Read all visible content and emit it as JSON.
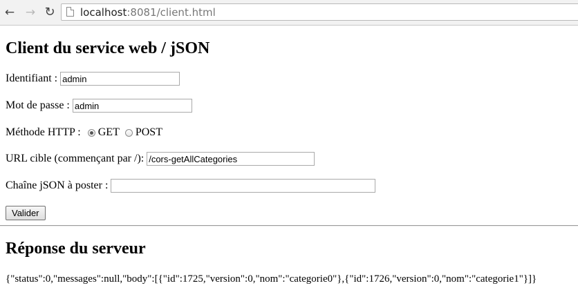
{
  "browser": {
    "url_host": "localhost",
    "url_rest": ":8081/client.html"
  },
  "form": {
    "title": "Client du service web / jSON",
    "identifiant": {
      "label": "Identifiant :",
      "value": "admin"
    },
    "mot_de_passe": {
      "label": "Mot de passe :",
      "value": "admin"
    },
    "methode": {
      "label": "Méthode HTTP :",
      "options": [
        {
          "label": "GET",
          "checked": true
        },
        {
          "label": "POST",
          "checked": false
        }
      ]
    },
    "url_cible": {
      "label": "URL cible (commençant par /):",
      "value": "/cors-getAllCategories"
    },
    "json": {
      "label": "Chaîne jSON à poster :",
      "value": ""
    },
    "submit_label": "Valider"
  },
  "reponse": {
    "title": "Réponse du serveur",
    "text": "{\"status\":0,\"messages\":null,\"body\":[{\"id\":1725,\"version\":0,\"nom\":\"categorie0\"},{\"id\":1726,\"version\":0,\"nom\":\"categorie1\"}]}"
  }
}
